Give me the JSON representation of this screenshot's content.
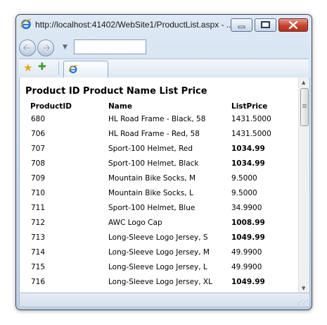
{
  "window": {
    "title": "http://localhost:41402/WebSite1/ProductList.aspx - ..."
  },
  "page": {
    "heading": "Product ID Product Name List Price"
  },
  "table": {
    "headers": {
      "id": "ProductID",
      "name": "Name",
      "price": "ListPrice"
    },
    "rows": [
      {
        "id": "680",
        "name": "HL Road Frame - Black, 58",
        "price": "1431.5000",
        "bold": false
      },
      {
        "id": "706",
        "name": "HL Road Frame - Red, 58",
        "price": "1431.5000",
        "bold": false
      },
      {
        "id": "707",
        "name": "Sport-100 Helmet, Red",
        "price": "1034.99",
        "bold": true
      },
      {
        "id": "708",
        "name": "Sport-100 Helmet, Black",
        "price": "1034.99",
        "bold": true
      },
      {
        "id": "709",
        "name": "Mountain Bike Socks, M",
        "price": "9.5000",
        "bold": false
      },
      {
        "id": "710",
        "name": "Mountain Bike Socks, L",
        "price": "9.5000",
        "bold": false
      },
      {
        "id": "711",
        "name": "Sport-100 Helmet, Blue",
        "price": "34.9900",
        "bold": false
      },
      {
        "id": "712",
        "name": "AWC Logo Cap",
        "price": "1008.99",
        "bold": true
      },
      {
        "id": "713",
        "name": "Long-Sleeve Logo Jersey, S",
        "price": "1049.99",
        "bold": true
      },
      {
        "id": "714",
        "name": "Long-Sleeve Logo Jersey, M",
        "price": "49.9900",
        "bold": false
      },
      {
        "id": "715",
        "name": "Long-Sleeve Logo Jersey, L",
        "price": "49.9900",
        "bold": false
      },
      {
        "id": "716",
        "name": "Long-Sleeve Logo Jersey, XL",
        "price": "1049.99",
        "bold": true
      }
    ]
  },
  "icons": {
    "browser_logo": "ie-logo-icon",
    "back": "back-arrow-icon",
    "forward": "forward-arrow-icon",
    "favorites": "favorites-star-icon",
    "add_favorite": "add-favorite-icon",
    "tab": "ie-page-icon"
  },
  "colors": {
    "window_frame": "#c9d9ec",
    "close_button": "#c4442c",
    "ie_blue": "#1e6fd0",
    "ie_gold": "#e6a817"
  }
}
